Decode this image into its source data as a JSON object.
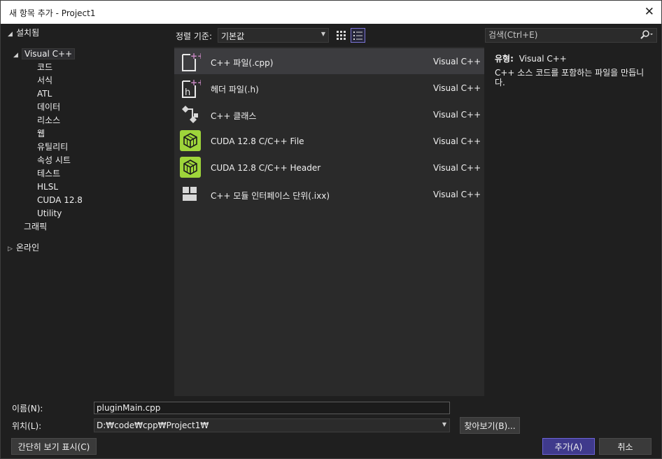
{
  "window": {
    "title": "새 항목 추가 - Project1",
    "close_glyph": "✕"
  },
  "tree": {
    "installed": "설치됨",
    "root": "Visual C++",
    "children": [
      "코드",
      "서식",
      "ATL",
      "데이터",
      "리소스",
      "웹",
      "유틸리티",
      "속성 시트",
      "테스트",
      "HLSL",
      "CUDA 12.8",
      "Utility"
    ],
    "graphics": "그래픽",
    "online": "온라인"
  },
  "toolbar": {
    "sort_label": "정렬 기준:",
    "sort_value": "기본값",
    "search_placeholder": "검색(Ctrl+E)"
  },
  "templates": [
    {
      "name": "C++ 파일(.cpp)",
      "lang": "Visual C++",
      "icon": "cpp-file-icon",
      "selected": true
    },
    {
      "name": "헤더 파일(.h)",
      "lang": "Visual C++",
      "icon": "header-file-icon",
      "selected": false
    },
    {
      "name": "C++ 클래스",
      "lang": "Visual C++",
      "icon": "cpp-class-icon",
      "selected": false
    },
    {
      "name": "CUDA 12.8 C/C++ File",
      "lang": "Visual C++",
      "icon": "cuda-icon",
      "selected": false
    },
    {
      "name": "CUDA 12.8 C/C++ Header",
      "lang": "Visual C++",
      "icon": "cuda-icon",
      "selected": false
    },
    {
      "name": "C++ 모듈 인터페이스 단위(.ixx)",
      "lang": "Visual C++",
      "icon": "module-icon",
      "selected": false
    }
  ],
  "info": {
    "type_label": "유형:",
    "type_value": "Visual C++",
    "description": "C++ 소스 코드를 포함하는 파일을 만듭니다."
  },
  "form": {
    "name_label": "이름(N):",
    "name_value": "pluginMain.cpp",
    "location_label": "위치(L):",
    "location_value": "D:₩code₩cpp₩Project1₩",
    "browse_label": "찾아보기(B)...",
    "compact_label": "간단히 보기 표시(C)",
    "add_label": "추가(A)",
    "cancel_label": "취소"
  },
  "colors": {
    "accent": "#6c63d6",
    "cuda_green": "#9ed53a",
    "cpp_pink": "#c586c0"
  }
}
